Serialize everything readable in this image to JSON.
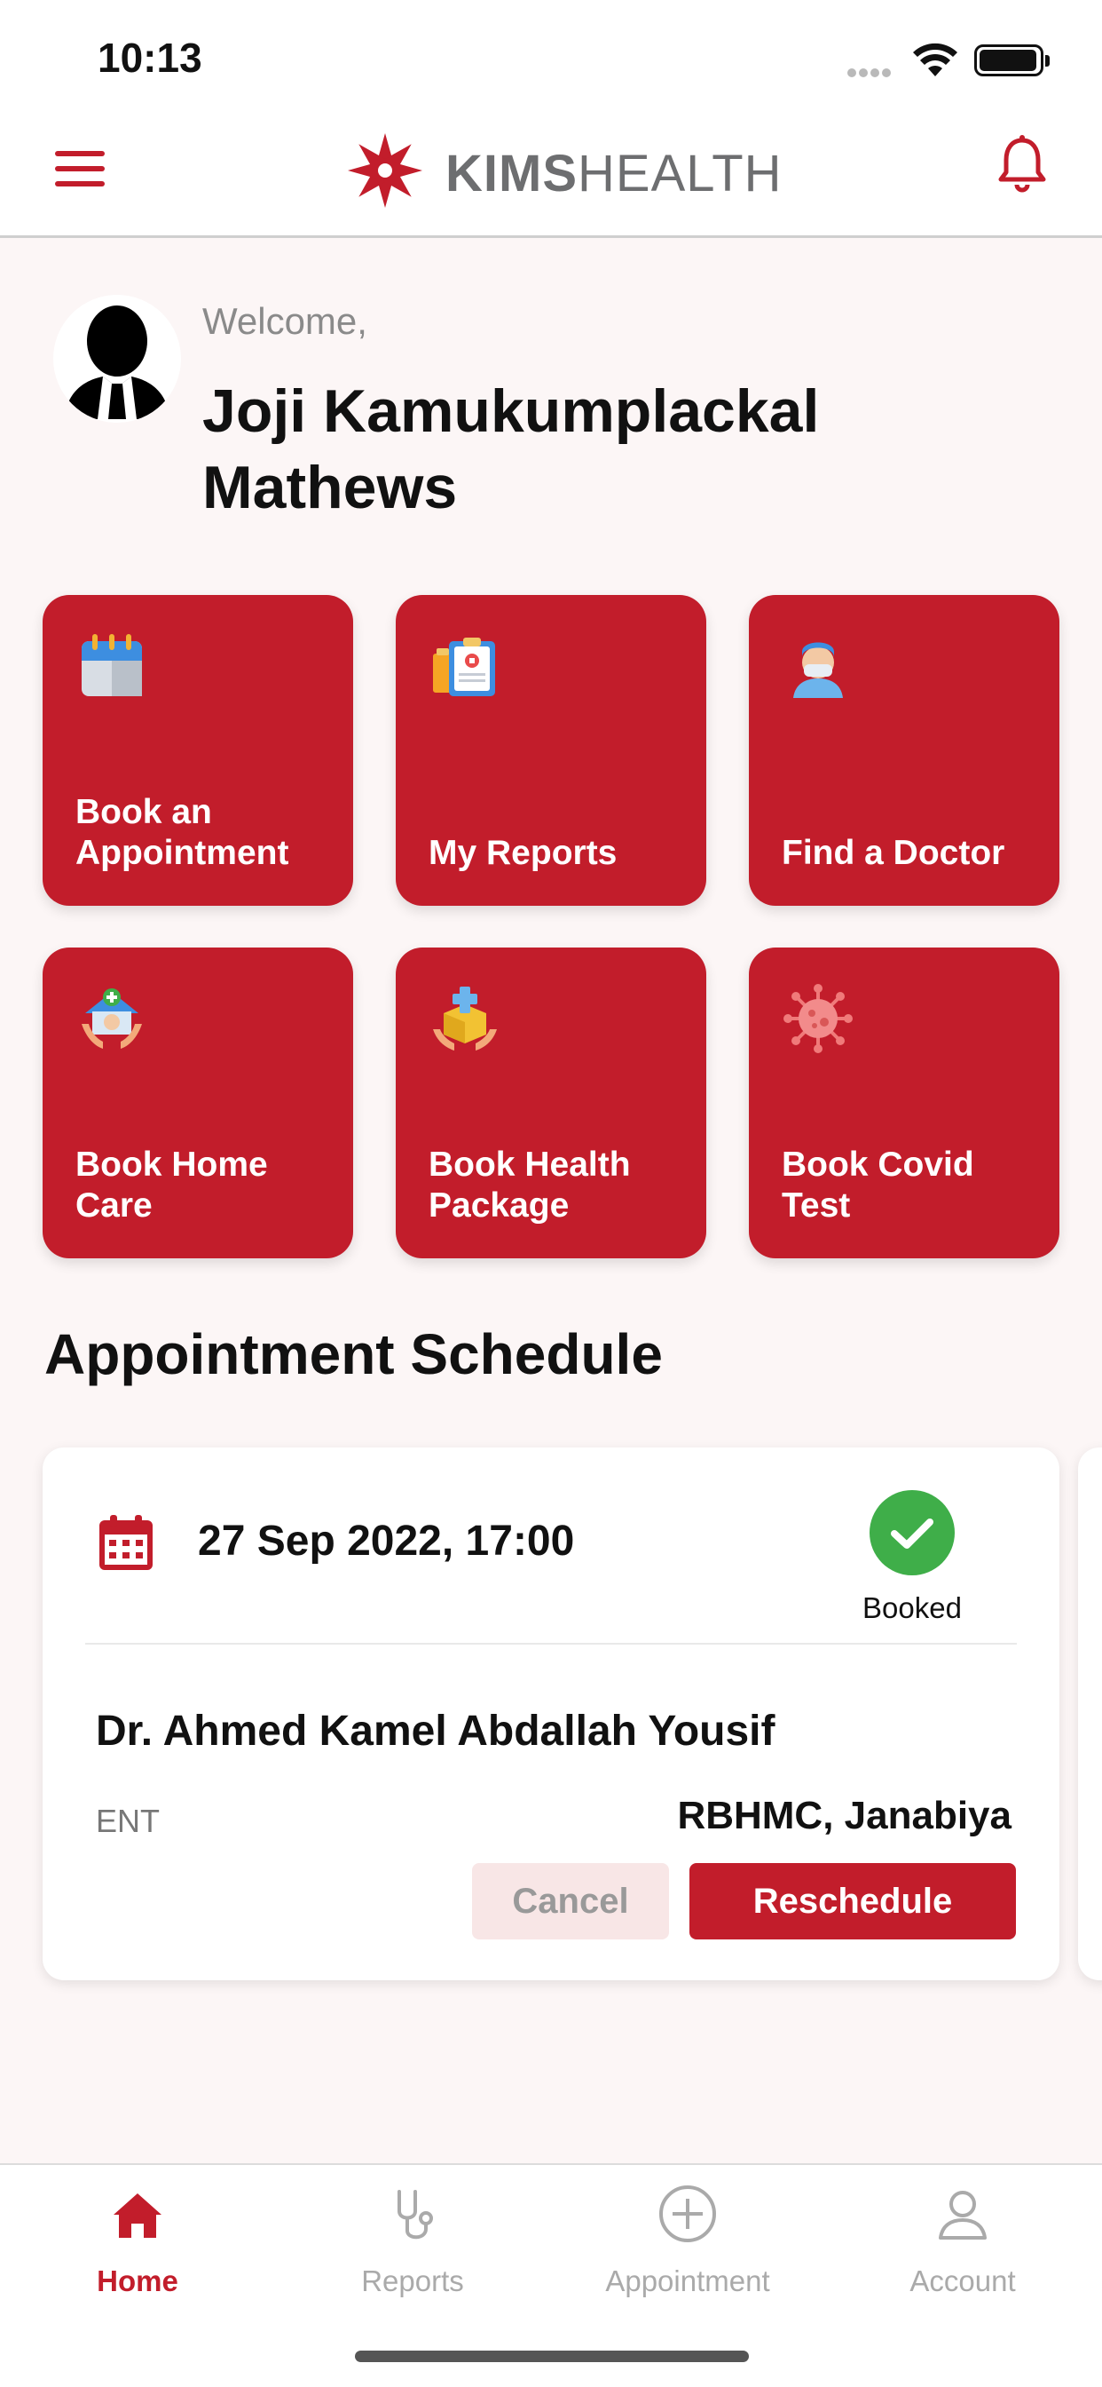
{
  "status_bar": {
    "time": "10:13"
  },
  "header": {
    "brand_bold": "KIMS",
    "brand_light": "HEALTH"
  },
  "welcome": {
    "greeting": "Welcome,",
    "name": "Joji Kamukumplackal Mathews"
  },
  "tiles": [
    {
      "label": "Book an Appointment",
      "icon": "calendar-icon"
    },
    {
      "label": "My Reports",
      "icon": "reports-icon"
    },
    {
      "label": "Find a Doctor",
      "icon": "doctor-icon"
    },
    {
      "label": "Book Home Care",
      "icon": "home-care-icon"
    },
    {
      "label": "Book Health Package",
      "icon": "health-package-icon"
    },
    {
      "label": "Book Covid Test",
      "icon": "virus-icon"
    }
  ],
  "schedule": {
    "title": "Appointment Schedule",
    "appointment": {
      "datetime": "27 Sep 2022, 17:00",
      "status": "Booked",
      "doctor": "Dr. Ahmed Kamel Abdallah Yousif",
      "specialty": "ENT",
      "location": "RBHMC, Janabiya",
      "cancel_label": "Cancel",
      "reschedule_label": "Reschedule"
    }
  },
  "tabbar": [
    {
      "label": "Home",
      "icon": "home-icon",
      "active": true
    },
    {
      "label": "Reports",
      "icon": "stethoscope-icon",
      "active": false
    },
    {
      "label": "Appointment",
      "icon": "plus-circle-icon",
      "active": false
    },
    {
      "label": "Account",
      "icon": "user-icon",
      "active": false
    }
  ],
  "colors": {
    "brand": "#c21d2b",
    "background": "#fcf6f6",
    "success": "#3fae49"
  }
}
